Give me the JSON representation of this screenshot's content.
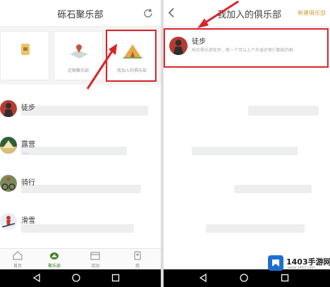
{
  "left": {
    "title": "砾石聚乐部",
    "cards": [
      {
        "label": "",
        "icon": "badge-icon"
      },
      {
        "label": "近期聚乐部",
        "icon": "map-pin-icon"
      },
      {
        "label": "我加入的俱乐部",
        "icon": "tent-icon"
      }
    ],
    "clubs": [
      {
        "name": "徒步",
        "desc": "",
        "avatar": "hiker-icon"
      },
      {
        "name": "露营",
        "desc": "——",
        "avatar": "camp-icon"
      },
      {
        "name": "骑行",
        "desc": "",
        "avatar": "cyclist-icon"
      },
      {
        "name": "滑雪",
        "desc": "",
        "avatar": "skier-icon"
      }
    ],
    "tabs": [
      "首页",
      "聚乐部",
      "活动",
      "我"
    ],
    "active_tab": 1
  },
  "right": {
    "title": "我加入的俱乐部",
    "new_club_label": "新建俱乐部",
    "joined": {
      "name": "徒步",
      "desc": "砾石俱乐部徒步，新一个可以上户外爱好者们都能的群",
      "time": ""
    }
  },
  "colors": {
    "accent_green": "#3e7f2e",
    "highlight_red": "#d9242a",
    "gold": "#c8a23a"
  },
  "watermark": {
    "text": "1403手游网",
    "sub": "www.1403.com"
  }
}
